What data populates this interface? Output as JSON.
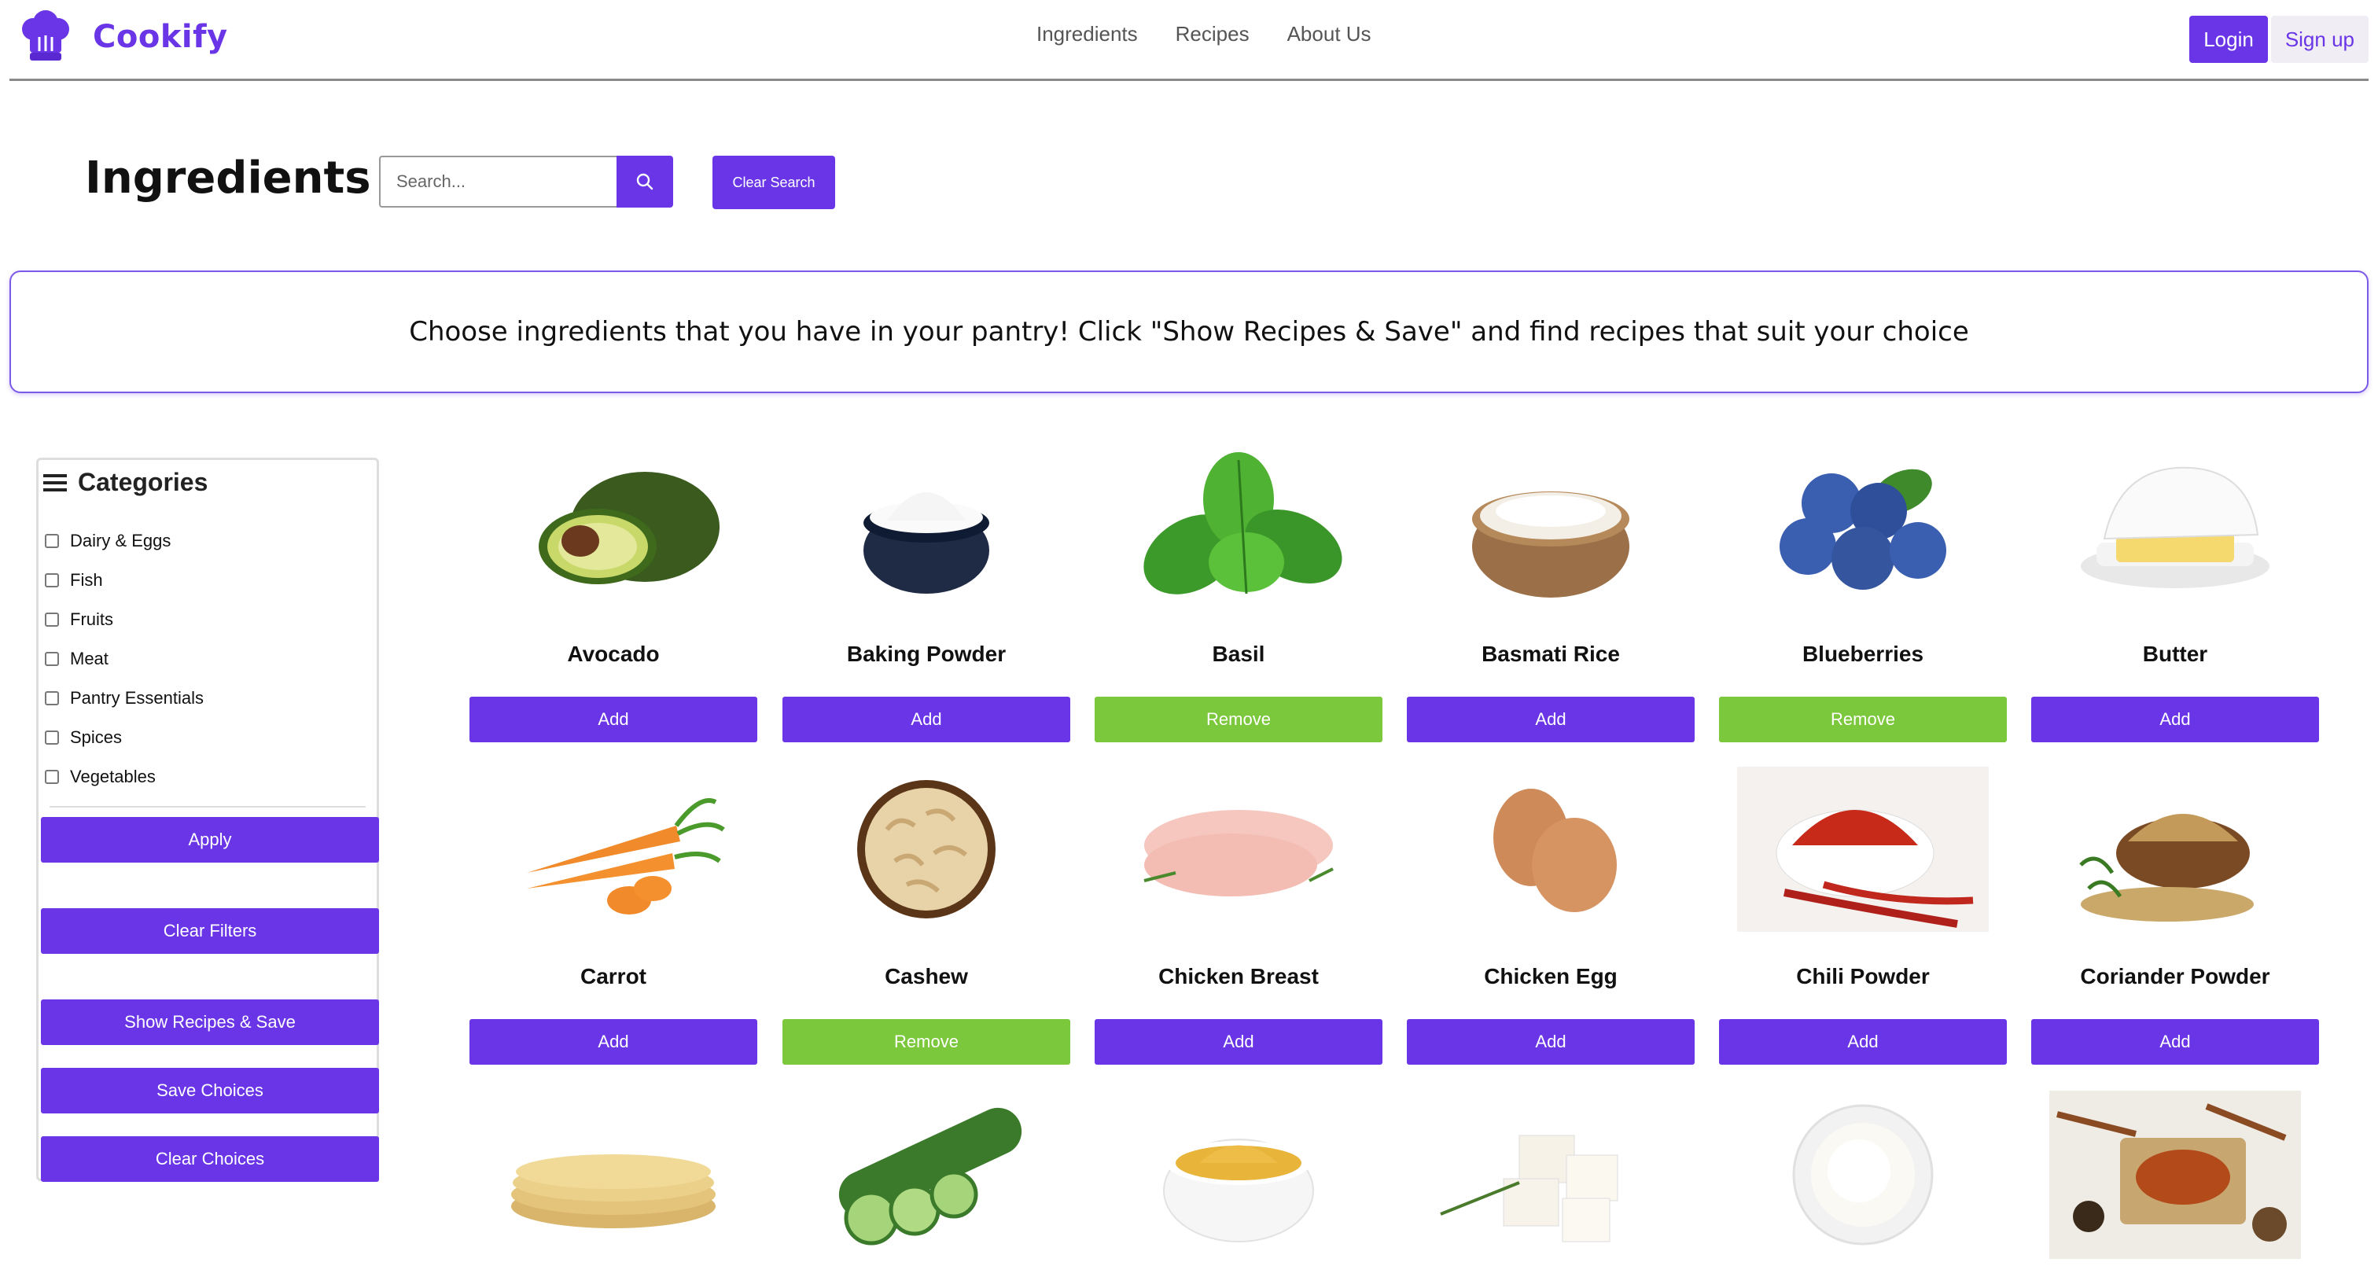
{
  "app": {
    "brand": "Cookify"
  },
  "nav": {
    "links": [
      "Ingredients",
      "Recipes",
      "About Us"
    ],
    "login": "Login",
    "signup": "Sign up"
  },
  "header": {
    "title": "Ingredients",
    "search_placeholder": "Search...",
    "search_value": "",
    "clear_search": "Clear Search"
  },
  "banner": {
    "text": "Choose ingredients that you have in your pantry! Click \"Show Recipes & Save\" and find recipes that suit your choice"
  },
  "sidebar": {
    "title": "Categories",
    "categories": [
      "Dairy & Eggs",
      "Fish",
      "Fruits",
      "Meat",
      "Pantry Essentials",
      "Spices",
      "Vegetables"
    ],
    "buttons": {
      "apply": "Apply",
      "clear_filters": "Clear Filters",
      "show_recipes": "Show Recipes & Save",
      "save_choices": "Save Choices",
      "clear_choices": "Clear Choices"
    }
  },
  "ingredients": [
    {
      "name": "Avocado",
      "action": "Add",
      "icon": "avocado-image"
    },
    {
      "name": "Baking Powder",
      "action": "Add",
      "icon": "baking-powder-image"
    },
    {
      "name": "Basil",
      "action": "Remove",
      "icon": "basil-image"
    },
    {
      "name": "Basmati Rice",
      "action": "Add",
      "icon": "basmati-rice-image"
    },
    {
      "name": "Blueberries",
      "action": "Remove",
      "icon": "blueberries-image"
    },
    {
      "name": "Butter",
      "action": "Add",
      "icon": "butter-image"
    },
    {
      "name": "Carrot",
      "action": "Add",
      "icon": "carrot-image"
    },
    {
      "name": "Cashew",
      "action": "Remove",
      "icon": "cashew-image"
    },
    {
      "name": "Chicken Breast",
      "action": "Add",
      "icon": "chicken-breast-image"
    },
    {
      "name": "Chicken Egg",
      "action": "Add",
      "icon": "chicken-egg-image"
    },
    {
      "name": "Chili Powder",
      "action": "Add",
      "icon": "chili-powder-image"
    },
    {
      "name": "Coriander Powder",
      "action": "Add",
      "icon": "coriander-powder-image"
    }
  ],
  "partial_row_images": [
    "tortilla-image",
    "cucumber-image",
    "mustard-image",
    "tofu-image",
    "flour-image",
    "spice-mix-image"
  ],
  "colors": {
    "primary": "#6a35e6",
    "remove": "#7cc83c"
  }
}
